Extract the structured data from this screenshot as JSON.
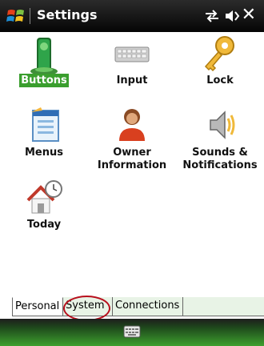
{
  "titlebar": {
    "title": "Settings",
    "icons": [
      "start-logo-icon",
      "connectivity-icon",
      "volume-icon",
      "close-icon"
    ],
    "close_glyph": "✕"
  },
  "items": [
    {
      "label_lines": [
        "Buttons"
      ],
      "icon": "buttons-icon",
      "selected": true
    },
    {
      "label_lines": [
        "Input"
      ],
      "icon": "keyboard-icon",
      "selected": false
    },
    {
      "label_lines": [
        "Lock"
      ],
      "icon": "key-icon",
      "selected": false
    },
    {
      "label_lines": [
        "Menus"
      ],
      "icon": "menus-icon",
      "selected": false
    },
    {
      "label_lines": [
        "Owner",
        "Information"
      ],
      "icon": "owner-icon",
      "selected": false
    },
    {
      "label_lines": [
        "Sounds &",
        "Notifications"
      ],
      "icon": "sounds-icon",
      "selected": false
    },
    {
      "label_lines": [
        "Today"
      ],
      "icon": "today-icon",
      "selected": false
    }
  ],
  "tabs": [
    {
      "label": "Personal",
      "active": true
    },
    {
      "label": "System",
      "active": false,
      "annotated": true
    },
    {
      "label": "Connections",
      "active": false
    }
  ],
  "bottombar": {
    "icon": "keyboard-toggle-icon"
  },
  "colors": {
    "selection": "#3a9e2e",
    "annotation": "#b80f1d",
    "inactive_tab": "#e8f3e6"
  }
}
